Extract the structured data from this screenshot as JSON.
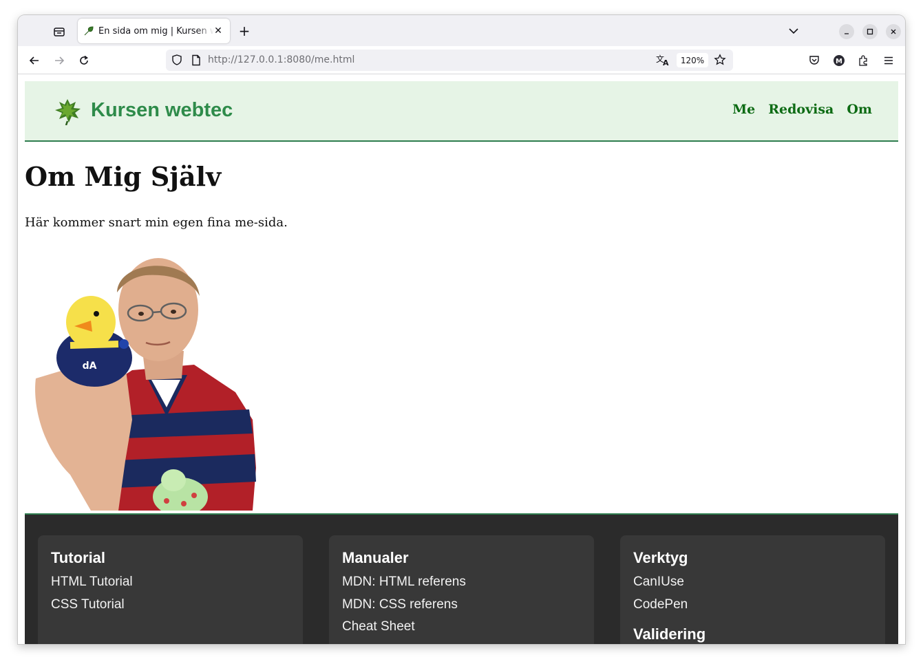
{
  "browser": {
    "tab": {
      "title": "En sida om mig | Kursen webtec"
    },
    "url": {
      "host": "http://127.0.0.1",
      "rest": ":8080/me.html"
    },
    "zoom": "120%"
  },
  "site": {
    "title": "Kursen webtec",
    "nav": [
      "Me",
      "Redovisa",
      "Om"
    ]
  },
  "main": {
    "heading": "Om Mig Själv",
    "paragraph": "Här kommer snart min egen fina me-sida."
  },
  "footer": {
    "columns": [
      {
        "heading": "Tutorial",
        "links": [
          "HTML Tutorial",
          "CSS Tutorial"
        ]
      },
      {
        "heading": "Manualer",
        "links": [
          "MDN: HTML referens",
          "MDN: CSS referens",
          "Cheat Sheet"
        ]
      },
      {
        "heading": "Verktyg",
        "links": [
          "CanIUse",
          "CodePen"
        ],
        "subheading": "Validering"
      }
    ]
  },
  "colors": {
    "header_bg": "#e6f4e6",
    "accent_green": "#2e8b4a",
    "nav_green": "#0d6b14",
    "footer_bg": "#2b2b2b",
    "footer_card": "#383838"
  },
  "icons": [
    "tab-list-icon",
    "plus-icon",
    "chevron-down-icon",
    "minimize-icon",
    "maximize-icon",
    "close-icon",
    "back-icon",
    "forward-icon",
    "reload-icon",
    "shield-icon",
    "page-icon",
    "translate-icon",
    "star-icon",
    "pocket-icon",
    "account-icon",
    "extensions-icon",
    "menu-icon",
    "leaf-icon"
  ]
}
